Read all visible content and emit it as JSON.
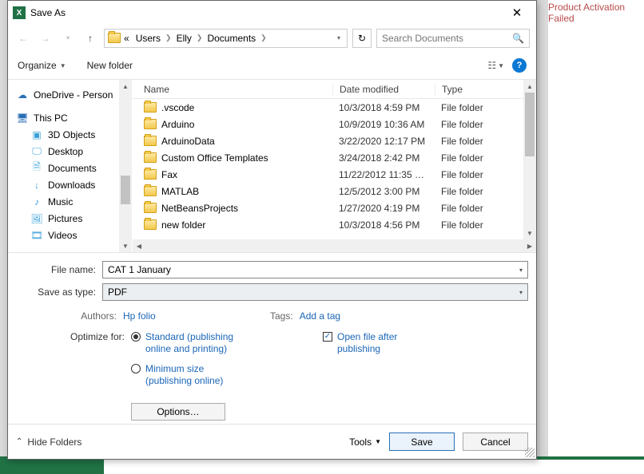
{
  "bg": {
    "activation": "Product Activation Failed"
  },
  "dialog": {
    "title": "Save As",
    "nav": {
      "crumbs_prefix": "«",
      "crumbs": [
        "Users",
        "Elly",
        "Documents"
      ]
    },
    "search": {
      "placeholder": "Search Documents"
    },
    "toolbar": {
      "organize": "Organize",
      "new_folder": "New folder"
    },
    "tree": [
      {
        "icon": "cloud",
        "label": "OneDrive - Person",
        "indent": false
      },
      {
        "icon": "pc",
        "label": "This PC",
        "indent": false
      },
      {
        "icon": "cube",
        "label": "3D Objects",
        "indent": true
      },
      {
        "icon": "desktop",
        "label": "Desktop",
        "indent": true
      },
      {
        "icon": "doc",
        "label": "Documents",
        "indent": true
      },
      {
        "icon": "download",
        "label": "Downloads",
        "indent": true
      },
      {
        "icon": "music",
        "label": "Music",
        "indent": true
      },
      {
        "icon": "pictures",
        "label": "Pictures",
        "indent": true
      },
      {
        "icon": "videos",
        "label": "Videos",
        "indent": true
      }
    ],
    "columns": {
      "name": "Name",
      "date": "Date modified",
      "type": "Type"
    },
    "files": [
      {
        "name": ".vscode",
        "date": "10/3/2018 4:59 PM",
        "type": "File folder"
      },
      {
        "name": "Arduino",
        "date": "10/9/2019 10:36 AM",
        "type": "File folder"
      },
      {
        "name": "ArduinoData",
        "date": "3/22/2020 12:17 PM",
        "type": "File folder"
      },
      {
        "name": "Custom Office Templates",
        "date": "3/24/2018 2:42 PM",
        "type": "File folder"
      },
      {
        "name": "Fax",
        "date": "11/22/2012 11:35 …",
        "type": "File folder"
      },
      {
        "name": "MATLAB",
        "date": "12/5/2012 3:00 PM",
        "type": "File folder"
      },
      {
        "name": "NetBeansProjects",
        "date": "1/27/2020 4:19 PM",
        "type": "File folder"
      },
      {
        "name": "new folder",
        "date": "10/3/2018 4:56 PM",
        "type": "File folder"
      }
    ],
    "form": {
      "filename_label": "File name:",
      "filename_value": "CAT 1 January",
      "saveastype_label": "Save as type:",
      "saveastype_value": "PDF",
      "authors_label": "Authors:",
      "authors_value": "Hp folio",
      "tags_label": "Tags:",
      "tags_value": "Add a tag",
      "optimize_label": "Optimize for:",
      "opt_standard": "Standard (publishing online and printing)",
      "opt_minimum": "Minimum size (publishing online)",
      "open_after": "Open file after publishing",
      "options_btn": "Options…"
    },
    "footer": {
      "hide_folders": "Hide Folders",
      "tools": "Tools",
      "save": "Save",
      "cancel": "Cancel"
    }
  }
}
